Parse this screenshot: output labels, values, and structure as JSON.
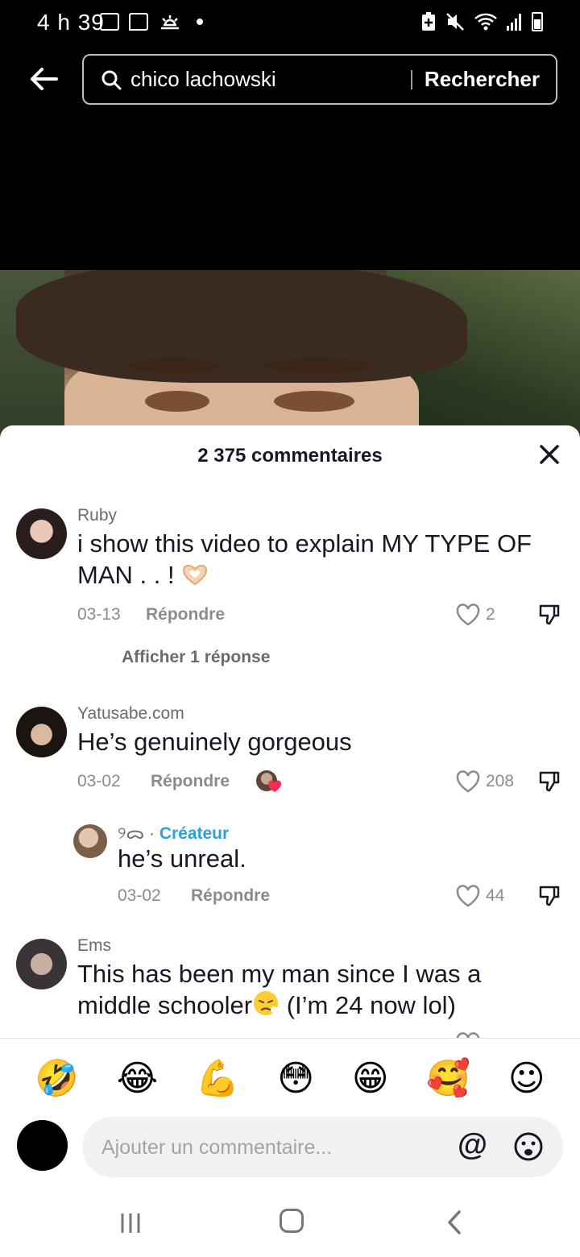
{
  "status_bar": {
    "time": "4 h 39"
  },
  "search": {
    "query": "chico lachowski",
    "button_label": "Rechercher"
  },
  "comments_sheet": {
    "title": "2 375 commentaires",
    "comments": [
      {
        "username": "Ruby",
        "text": "i show this video to explain MY TYPE OF MAN . . !",
        "emoji": "heart-hands",
        "date": "03-13",
        "reply_label": "Répondre",
        "likes": "2",
        "view_replies": "Afficher 1 réponse"
      },
      {
        "username": "Yatusabe.com",
        "text": "He’s genuinely gorgeous",
        "date": "03-02",
        "reply_label": "Répondre",
        "likes": "208"
      },
      {
        "username": "୨ᯅ",
        "creator_label": "Créateur",
        "text": "he’s unreal.",
        "date": "03-02",
        "reply_label": "Répondre",
        "likes": "44"
      },
      {
        "username": "Ems",
        "text_line1": "This has been my man since I was a",
        "text_line2_a": "middle schooler",
        "text_line2_b": " (I’m 24 now lol)"
      }
    ]
  },
  "emoji_bar": [
    "🤣",
    "😂",
    "💪",
    "😳",
    "😁",
    "🥰",
    "☺"
  ],
  "comment_input": {
    "placeholder": "Ajouter un commentaire...",
    "at_label": "@"
  }
}
